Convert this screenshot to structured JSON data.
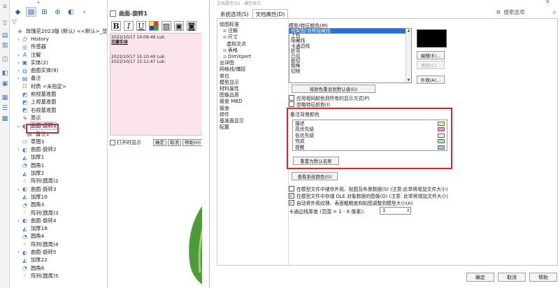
{
  "feature_tree": {
    "top_tab": "+",
    "toolbar_icons": [
      "tree-view-icon",
      "property-icon",
      "config-icon",
      "target-icon",
      "appearance-icon",
      "more-icon"
    ],
    "rows": [
      {
        "label": "玫瑰花2023版 (默认) <<默认>_显示",
        "icon": "part-icon",
        "indent": 0
      },
      {
        "label": "History",
        "icon": "history-icon",
        "indent": 1
      },
      {
        "label": "传感器",
        "icon": "sensor-icon",
        "indent": 1
      },
      {
        "label": "注解",
        "icon": "annotation-icon",
        "indent": 1
      },
      {
        "label": "实体(2)",
        "icon": "solid-body-icon",
        "indent": 1
      },
      {
        "label": "曲面实体(9)",
        "icon": "surface-body-icon",
        "indent": 1
      },
      {
        "label": "备注",
        "icon": "note-icon",
        "indent": 1
      },
      {
        "label": "材质 <未指定>",
        "icon": "material-icon",
        "indent": 1
      },
      {
        "label": "前视基准面",
        "icon": "plane-icon",
        "indent": 1
      },
      {
        "label": "上视基准面",
        "icon": "plane-icon",
        "indent": 1
      },
      {
        "label": "右视基准面",
        "icon": "plane-icon",
        "indent": 1
      },
      {
        "label": "原点",
        "icon": "origin-icon",
        "indent": 1
      },
      {
        "label": "曲面-旋转1",
        "icon": "revolve-icon",
        "indent": 1,
        "selected": true
      },
      {
        "label": "备注1",
        "icon": "note-icon",
        "indent": 2
      },
      {
        "label": "草图3",
        "icon": "sketch-icon",
        "indent": 1
      },
      {
        "label": "曲面-旋转2",
        "icon": "revolve-icon",
        "indent": 1
      },
      {
        "label": "加厚1",
        "icon": "thicken-icon",
        "indent": 1
      },
      {
        "label": "圆角1",
        "icon": "fillet-icon",
        "indent": 1
      },
      {
        "label": "加厚2",
        "icon": "thicken-icon",
        "indent": 1
      },
      {
        "label": "阵列(圆周)2",
        "icon": "pattern-icon",
        "indent": 1
      },
      {
        "label": "曲面-旋转3",
        "icon": "revolve-icon",
        "indent": 1
      },
      {
        "label": "加厚10",
        "icon": "thicken-icon",
        "indent": 1
      },
      {
        "label": "圆角3",
        "icon": "fillet-icon",
        "indent": 1
      },
      {
        "label": "阵列(圆周)3",
        "icon": "pattern-icon",
        "indent": 1
      },
      {
        "label": "曲面-旋转4",
        "icon": "revolve-icon",
        "indent": 1
      },
      {
        "label": "加厚18",
        "icon": "thicken-icon",
        "indent": 1
      },
      {
        "label": "圆角4",
        "icon": "fillet-icon",
        "indent": 1
      },
      {
        "label": "阵列(圆周)4",
        "icon": "pattern-icon",
        "indent": 1
      },
      {
        "label": "曲面-旋转5",
        "icon": "revolve-icon",
        "indent": 1
      },
      {
        "label": "加厚22",
        "icon": "thicken-icon",
        "indent": 1
      },
      {
        "label": "圆角6",
        "icon": "fillet-icon",
        "indent": 1
      },
      {
        "label": "阵列(圆周)5",
        "icon": "pattern-icon",
        "indent": 1
      }
    ]
  },
  "note_panel": {
    "title": "曲面-旋转1",
    "format_buttons": [
      "B",
      "I",
      "U"
    ],
    "note_lines": [
      {
        "text": "2022/10/17 14:09:46 Luk:",
        "bold": false
      },
      {
        "text": "花瓣实体",
        "bold": true
      },
      {
        "text": "",
        "bold": false
      },
      {
        "text": "",
        "bold": false
      },
      {
        "text": "2022/10/17 15:10:40 Luk:",
        "bold": false
      },
      {
        "text": "2022/10/17 15:11:47 Luk:",
        "bold": false
      }
    ],
    "open_checkbox_label": "打开时显示",
    "ok_label": "确定",
    "cancel_label": "取消",
    "help_label": "帮助(H)"
  },
  "dialog": {
    "title": "文档属性(D) - 模型显示",
    "close_glyph": "×",
    "tabs": [
      {
        "label": "系统选项(S)",
        "active": false
      },
      {
        "label": "文档属性(D)",
        "active": true
      }
    ],
    "search_label": "搜索选项",
    "categories": [
      {
        "label": "绘图标准",
        "level": 0,
        "pm": ""
      },
      {
        "label": "注解",
        "level": 1,
        "pm": "⊞"
      },
      {
        "label": "尺寸",
        "level": 1,
        "pm": "⊞"
      },
      {
        "label": "虚拟交点",
        "level": 2,
        "pm": ""
      },
      {
        "label": "表格",
        "level": 1,
        "pm": "⊞"
      },
      {
        "label": "DimXpert",
        "level": 1,
        "pm": "⊞"
      },
      {
        "label": "出详图",
        "level": 0,
        "pm": ""
      },
      {
        "label": "网格线/捕捉",
        "level": 0,
        "pm": ""
      },
      {
        "label": "单位",
        "level": 0,
        "pm": ""
      },
      {
        "label": "模型显示",
        "level": 0,
        "pm": ""
      },
      {
        "label": "材料属性",
        "level": 0,
        "pm": ""
      },
      {
        "label": "图像品质",
        "level": 0,
        "pm": ""
      },
      {
        "label": "钣金 MBD",
        "level": 0,
        "pm": ""
      },
      {
        "label": "钣金",
        "level": 0,
        "pm": ""
      },
      {
        "label": "焊件",
        "level": 0,
        "pm": ""
      },
      {
        "label": "基准面显示",
        "level": 0,
        "pm": ""
      },
      {
        "label": "配置",
        "level": 0,
        "pm": ""
      }
    ],
    "model_colors_label": "模型/特征颜色(M)",
    "model_color_items": [
      "线架图/消除隐藏线",
      "上色",
      "隐藏线",
      "卡通边线",
      "折弯",
      "凸台",
      "剖切",
      "倒角",
      "切除"
    ],
    "edit_label": "编辑(E)...",
    "clear_label": "清除(C)...",
    "appearance_label": "外观(A)...",
    "reset_colors_label": "将颜色重设到默认值(D)",
    "check_same_color": "应用相同颜色到所有的显示方式(P)",
    "check_ignore_feature": "忽略特征颜色(I)",
    "note_bg_group_label": "备注背景颜色",
    "note_bg_items": [
      {
        "label": "描述",
        "color": "#f3e68a"
      },
      {
        "label": "高优先级",
        "color": "#ee9aa8"
      },
      {
        "label": "低优先级",
        "color": "#e8e8e8"
      },
      {
        "label": "完成",
        "color": "#b7e3a7"
      },
      {
        "label": "提醒",
        "color": "#8ed1e6"
      }
    ],
    "reset_names_label": "重置为默认名称",
    "view_system_colors_label": "查看系统颜色(G)",
    "check_store_appearance": "在模型文件中储存外观、贴图及布景数据(S) (注意:此举将增加文件大小)",
    "check_store_ole": "在模型文件中存储 OLE 对象数据的图像(O) (注意: 此举将增加文件大小)",
    "check_auto_resize": "自动将外观纹理、表面粗糙度和贴图调整到模型大小(A)",
    "cartoon_edge_label": "卡通边线厚度 (范围 = 1 - 6 像素):",
    "cartoon_edge_value": "1",
    "ok_label": "确定",
    "cancel_label": "取消",
    "help_label": "帮助"
  },
  "colors": {
    "highlight_box": "#e0242c",
    "selection_blue": "#1a73e8",
    "note_area_bg": "#fce4ec"
  }
}
